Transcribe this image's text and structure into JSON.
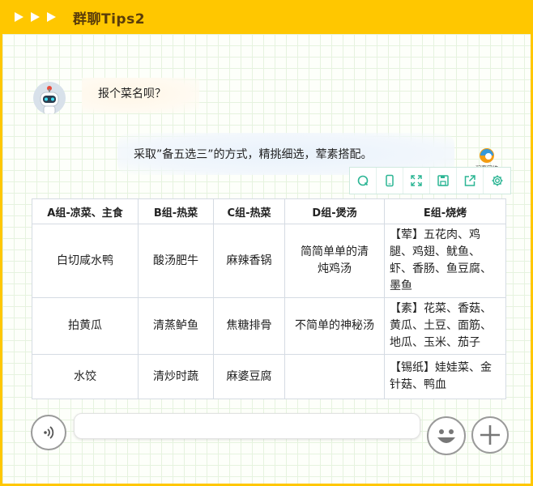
{
  "window": {
    "title": "群聊Tips2"
  },
  "messages": [
    {
      "text": "报个菜名呗？"
    },
    {
      "text": "采取”备五选三”的方式，精挑细选，荤素搭配。"
    }
  ],
  "brand": {
    "text": "润裔网络"
  },
  "toolbar": {
    "icons": [
      "search-icon",
      "mobile-icon",
      "fullscreen-icon",
      "save-icon",
      "share-icon",
      "settings-icon"
    ]
  },
  "table": {
    "headers": [
      "A组-凉菜、主食",
      "B组-热菜",
      "C组-热菜",
      "D组-煲汤",
      "E组-烧烤"
    ],
    "rows": [
      [
        "白切咸水鸭",
        "酸汤肥牛",
        "麻辣香锅",
        "简简单单的清炖鸡汤",
        "【荤】五花肉、鸡腿、鸡翅、鱿鱼、虾、香肠、鱼豆腐、墨鱼"
      ],
      [
        "拍黄瓜",
        "清蒸鲈鱼",
        "焦糖排骨",
        "不简单的神秘汤",
        "【素】花菜、香菇、黄瓜、土豆、面筋、地瓜、玉米、茄子"
      ],
      [
        "水饺",
        "清炒时蔬",
        "麻婆豆腐",
        "",
        "【锡纸】娃娃菜、金针菇、鸭血"
      ]
    ]
  },
  "colors": {
    "accent": "#ffc700",
    "title_text": "#5a3d0a",
    "toolbar_icon": "#2bb594"
  },
  "input": {
    "value": ""
  }
}
